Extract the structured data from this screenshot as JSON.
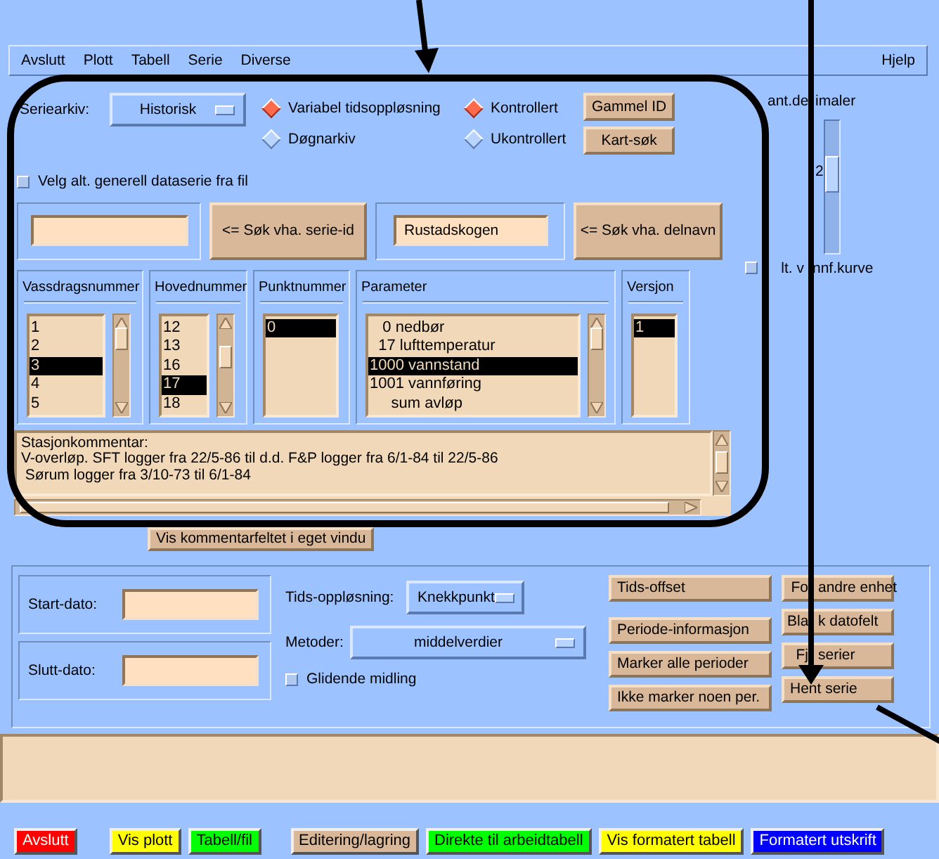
{
  "menu": [
    {
      "label": "Avslutt"
    },
    {
      "label": "Plott"
    },
    {
      "label": "Tabell"
    },
    {
      "label": "Serie"
    },
    {
      "label": "Diverse"
    }
  ],
  "help_menu": "Hjelp",
  "series_archive": {
    "label": "Seriearkiv:",
    "value": "Historisk"
  },
  "resolution_options": [
    {
      "label": "Variabel tidsoppløsning",
      "selected": true
    },
    {
      "label": "Døgnarkiv",
      "selected": false
    }
  ],
  "control_options": [
    {
      "label": "Kontrollert",
      "selected": true
    },
    {
      "label": "Ukontrollert",
      "selected": false
    }
  ],
  "id_buttons": [
    "Gammel ID",
    "Kart-søk"
  ],
  "file_checkbox": {
    "label": "Velg alt. generell dataserie fra fil",
    "checked": false
  },
  "search": [
    {
      "button": "<= Søk vha. serie-id"
    },
    {
      "value": "Rustadskogen",
      "button": "<= Søk vha. delnavn"
    }
  ],
  "lists": [
    {
      "title": "Vassdragsnummer",
      "scrollbar": true,
      "items": [
        {
          "text": "1",
          "selected": false
        },
        {
          "text": "2",
          "selected": false
        },
        {
          "text": "3",
          "selected": true
        },
        {
          "text": "4",
          "selected": false
        },
        {
          "text": "5",
          "selected": false
        }
      ]
    },
    {
      "title": "Hovednummer",
      "scrollbar": true,
      "items": [
        {
          "text": "12",
          "selected": false
        },
        {
          "text": "13",
          "selected": false
        },
        {
          "text": "16",
          "selected": false
        },
        {
          "text": "17",
          "selected": true
        },
        {
          "text": "18",
          "selected": false
        }
      ]
    },
    {
      "title": "Punktnummer",
      "scrollbar": false,
      "items": [
        {
          "text": "0",
          "selected": true
        }
      ]
    },
    {
      "title": "Parameter",
      "scrollbar": true,
      "items": [
        {
          "number": "0",
          "text": "nedbør",
          "selected": false
        },
        {
          "number": "17",
          "text": "lufttemperatur",
          "selected": false
        },
        {
          "number": "1000",
          "text": "vannstand",
          "selected": true
        },
        {
          "number": "1001",
          "text": "vannføring",
          "selected": false
        },
        {
          "text": "sum avløp",
          "selected": false
        }
      ]
    },
    {
      "title": "Versjon",
      "scrollbar": false,
      "items": [
        {
          "text": "1",
          "selected": true
        }
      ]
    }
  ],
  "comment": {
    "lines": [
      "Stasjonkommentar:",
      "V-overløp. SFT logger fra 22/5-86 til d.d. F&P logger fra 6/1-84 til 22/5-86",
      " Sørum logger fra 3/10-73 til 6/1-84"
    ]
  },
  "comment_window_button": "Vis kommentarfeltet i eget vindu",
  "decimals": {
    "label_parts": [
      "ant.de",
      "imaler"
    ],
    "reading": "2",
    "level": 0.65
  },
  "rating_curve_checkbox": {
    "label_parts": [
      "lt. v",
      "nnf.kurve"
    ],
    "checked": false
  },
  "dates": [
    {
      "label": "Start-dato:"
    },
    {
      "label": "Slutt-dato:"
    }
  ],
  "time_resolution": {
    "label": "Tids-oppløsning:",
    "value": "Knekkpunkt"
  },
  "methods": {
    "label": "Metoder:",
    "value": "middelverdier"
  },
  "moving_average": {
    "label": "Glidende midling",
    "checked": false
  },
  "period_buttons": [
    "Tids-offset",
    "Periode-informasjon",
    "Marker alle perioder",
    "Ikke marker noen per."
  ],
  "series_buttons": [
    {
      "parts": [
        "Fo",
        "andre enhet"
      ]
    },
    {
      "parts": [
        "Bla",
        "k datofelt"
      ]
    },
    {
      "parts": [
        "Fj",
        "serier"
      ]
    },
    {
      "parts": [
        "Hent serie"
      ]
    }
  ],
  "bottom_buttons": [
    {
      "label": "Avslutt",
      "color": "#ff0000"
    },
    {
      "label": "Vis plott",
      "color": "#ffff00"
    },
    {
      "label": "Tabell/fil",
      "color": "#00ff00"
    },
    {
      "label": "Editering/lagring",
      "color": "#d8b898"
    },
    {
      "label": "Direkte til arbeidtabell",
      "color": "#00ff00"
    },
    {
      "label": "Vis formatert tabell",
      "color": "#ffff00"
    },
    {
      "label": "Formatert utskrift",
      "color": "#0000ff"
    }
  ]
}
